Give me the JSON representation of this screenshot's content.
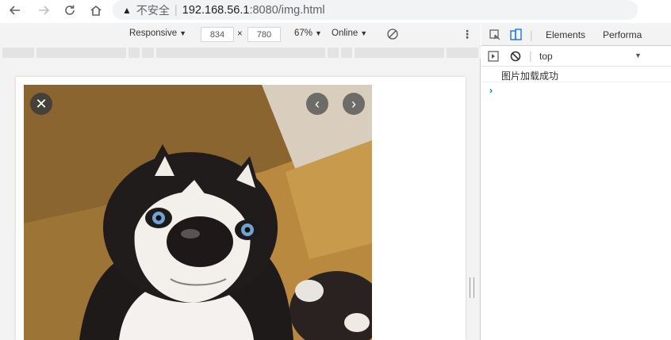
{
  "browser": {
    "address_bar": {
      "security_label": "不安全",
      "url_host": "192.168.56.1",
      "url_rest": ":8080/img.html"
    }
  },
  "device_toolbar": {
    "mode": "Responsive",
    "width": "834",
    "times": "×",
    "height": "780",
    "zoom": "67%",
    "throttle": "Online"
  },
  "devtools": {
    "tabs": [
      "Elements",
      "Performa"
    ],
    "context": "top",
    "console_log": "图片加载成功",
    "prompt": "›"
  },
  "colors": {
    "accent_blue": "#1a73e8",
    "toolbar_bg": "#f3f3f3"
  }
}
